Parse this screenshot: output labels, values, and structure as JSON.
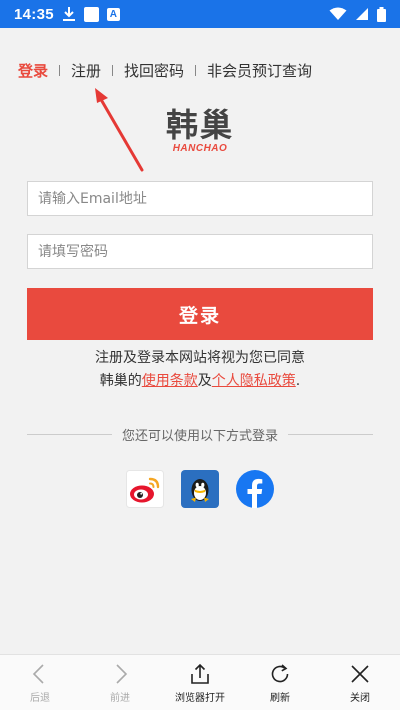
{
  "status_bar": {
    "time": "14:35"
  },
  "nav": {
    "login": "登录",
    "register": "注册",
    "recover_password": "找回密码",
    "guest_booking": "非会员预订查询"
  },
  "logo": {
    "cn": "韩巢",
    "en": "HANCHAO"
  },
  "form": {
    "email_placeholder": "请输入Email地址",
    "password_placeholder": "请填写密码",
    "submit_label": "登录"
  },
  "agreement": {
    "line1": "注册及登录本网站将视为您已同意",
    "prefix": "韩巢的",
    "terms": "使用条款",
    "conj": "及",
    "privacy": "个人隐私政策",
    "suffix": "."
  },
  "social": {
    "divider_text": "您还可以使用以下方式登录",
    "providers": [
      "weibo-icon",
      "qq-icon",
      "facebook-icon"
    ]
  },
  "browser_toolbar": {
    "back": "后退",
    "forward": "前进",
    "open_in_browser": "浏览器打开",
    "refresh": "刷新",
    "close": "关闭"
  },
  "colors": {
    "accent": "#e94a3e",
    "status_bar": "#1a73e8",
    "facebook": "#1877f2",
    "qq_bg": "#2b6fc0"
  }
}
